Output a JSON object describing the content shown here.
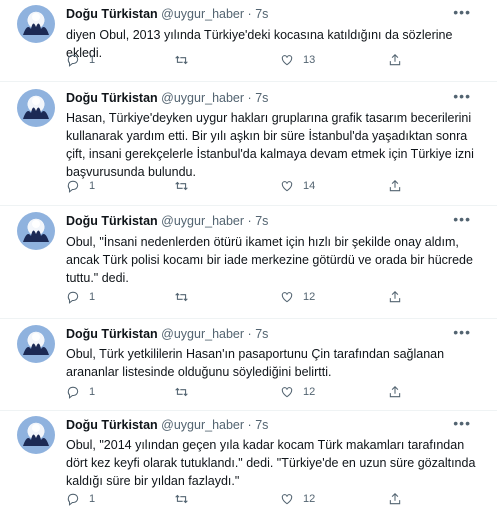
{
  "tweets": [
    {
      "name": "Doğu Türkistan",
      "handle": "@uygur_haber",
      "dot": "·",
      "time": "7s",
      "lines": [
        "diyen Obul, 2013 yılında Türkiye'deki kocasına katıldığını da sözlerine ekledi."
      ],
      "replies": "1",
      "retweets": "",
      "likes": "13"
    },
    {
      "name": "Doğu Türkistan",
      "handle": "@uygur_haber",
      "dot": "·",
      "time": "7s",
      "lines": [
        "Hasan, Türkiye'deyken uygur hakları gruplarına grafik tasarım becerilerini",
        "kullanarak yardım etti. Bir yılı aşkın bir süre İstanbul'da yaşadıktan sonra",
        "çift, insani gerekçelerle İstanbul'da kalmaya devam etmek için Türkiye izni",
        "başvurusunda bulundu."
      ],
      "replies": "1",
      "retweets": "",
      "likes": "14"
    },
    {
      "name": "Doğu Türkistan",
      "handle": "@uygur_haber",
      "dot": "·",
      "time": "7s",
      "lines": [
        "Obul, \"İnsani nedenlerden ötürü ikamet için hızlı bir şekilde onay aldım,",
        "ancak Türk polisi kocamı bir iade merkezine götürdü ve orada bir hücrede",
        "tuttu.\" dedi."
      ],
      "replies": "1",
      "retweets": "",
      "likes": "12"
    },
    {
      "name": "Doğu Türkistan",
      "handle": "@uygur_haber",
      "dot": "·",
      "time": "7s",
      "lines": [
        "Obul, Türk yetkililerin Hasan'ın pasaportunu Çin tarafından sağlanan",
        "arananlar listesinde olduğunu söylediğini belirtti."
      ],
      "replies": "1",
      "retweets": "",
      "likes": "12"
    },
    {
      "name": "Doğu Türkistan",
      "handle": "@uygur_haber",
      "dot": "·",
      "time": "7s",
      "lines": [
        "Obul, \"2014 yılından geçen yıla kadar kocam Türk makamları tarafından",
        "dört kez keyfi olarak tutuklandı.\" dedi. \"Türkiye'de en uzun süre gözaltında",
        "kaldığı süre bir yıldan fazlaydı.\""
      ],
      "replies": "1",
      "retweets": "",
      "likes": "12"
    }
  ],
  "icons": {
    "more": "more-icon",
    "reply": "reply-icon",
    "retweet": "retweet-icon",
    "like": "like-icon",
    "share": "share-icon"
  },
  "colors": {
    "text": "#0f1419",
    "muted": "#536471",
    "divider": "#eff3f4",
    "avatar": "#8fb2de"
  }
}
